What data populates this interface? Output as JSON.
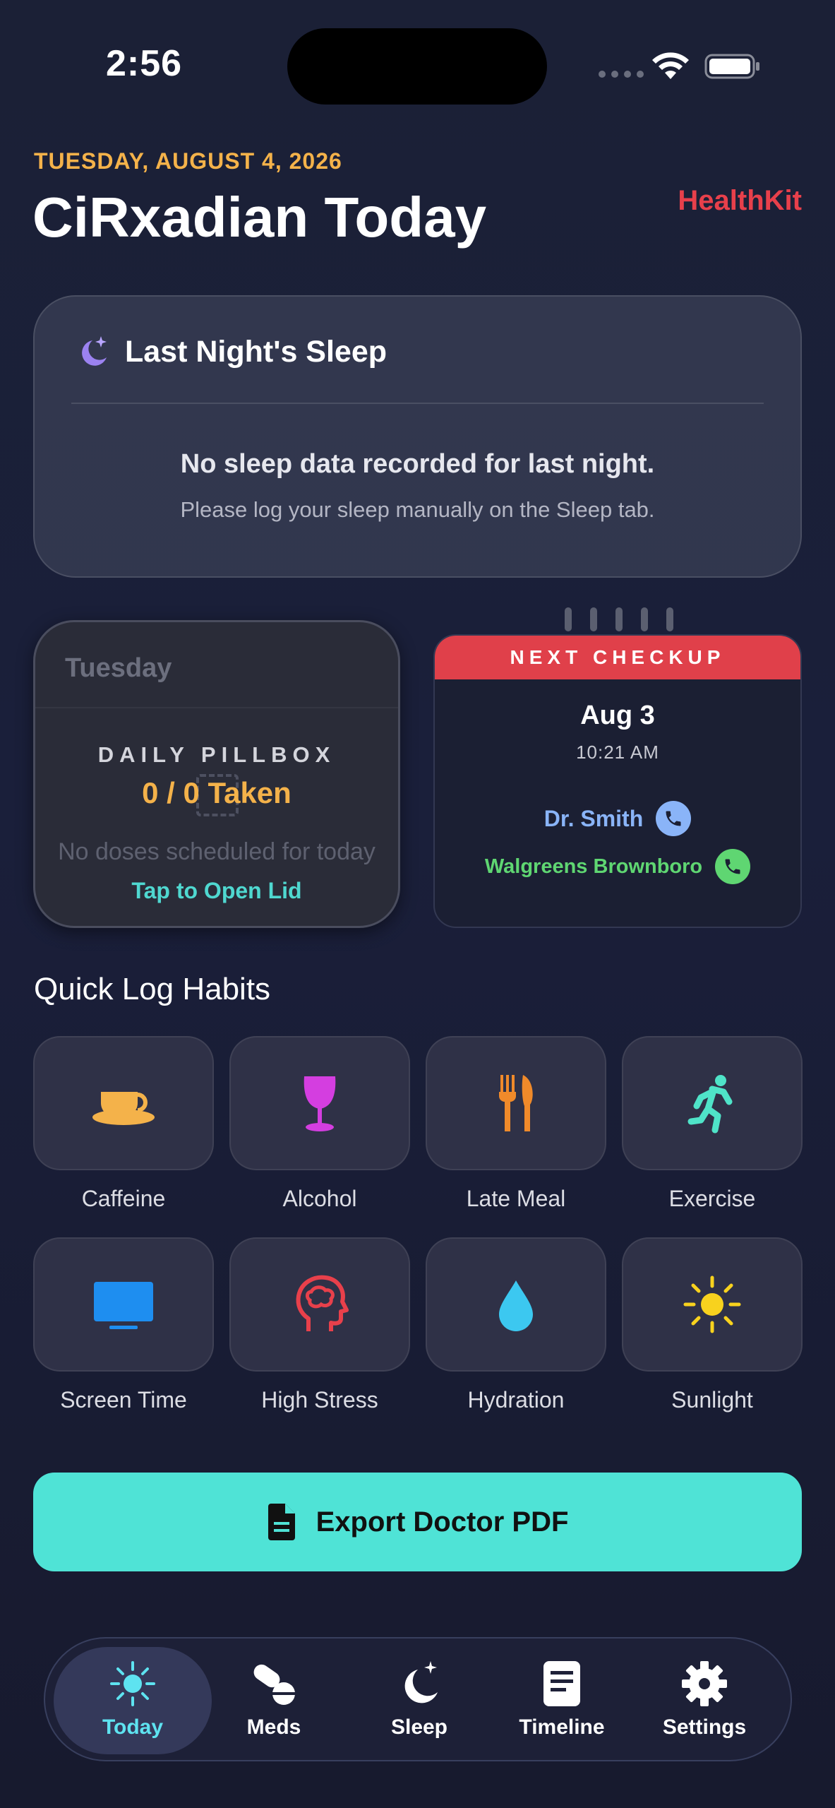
{
  "status_bar": {
    "time": "2:56"
  },
  "header": {
    "date": "TUESDAY, AUGUST 4, 2026",
    "title": "CiRxadian Today",
    "healthkit_label": "HealthKit"
  },
  "sleep_card": {
    "title": "Last Night's Sleep",
    "message": "No sleep data recorded for last night.",
    "hint": "Please log your sleep manually on the Sleep tab."
  },
  "pillbox": {
    "day": "Tuesday",
    "label": "DAILY PILLBOX",
    "count": "0 / 0 Taken",
    "empty_message": "No doses scheduled for today",
    "open_label": "Tap to Open Lid"
  },
  "checkup": {
    "banner": "NEXT CHECKUP",
    "date": "Aug 3",
    "time": "10:21 AM",
    "doctor": "Dr. Smith",
    "pharmacy": "Walgreens Brownboro"
  },
  "habits": {
    "title": "Quick Log Habits",
    "items": [
      {
        "label": "Caffeine",
        "icon": "coffee-cup-icon",
        "color": "#f4b24a"
      },
      {
        "label": "Alcohol",
        "icon": "wine-glass-icon",
        "color": "#d43ee0"
      },
      {
        "label": "Late Meal",
        "icon": "fork-knife-icon",
        "color": "#f08a2a"
      },
      {
        "label": "Exercise",
        "icon": "running-figure-icon",
        "color": "#4fe3c8"
      },
      {
        "label": "Screen Time",
        "icon": "monitor-icon",
        "color": "#1e8ef0"
      },
      {
        "label": "High Stress",
        "icon": "brain-head-icon",
        "color": "#e8404b"
      },
      {
        "label": "Hydration",
        "icon": "water-drop-icon",
        "color": "#3cc8f0"
      },
      {
        "label": "Sunlight",
        "icon": "sun-icon",
        "color": "#f8d21e"
      }
    ]
  },
  "export_button": {
    "label": "Export Doctor PDF"
  },
  "tab_bar": {
    "tabs": [
      {
        "label": "Today",
        "icon": "sun-icon",
        "active": true
      },
      {
        "label": "Meds",
        "icon": "pill-icon",
        "active": false
      },
      {
        "label": "Sleep",
        "icon": "moon-stars-icon",
        "active": false
      },
      {
        "label": "Timeline",
        "icon": "document-icon",
        "active": false
      },
      {
        "label": "Settings",
        "icon": "gear-icon",
        "active": false
      }
    ]
  },
  "colors": {
    "accent_teal": "#4fe3d6",
    "accent_orange": "#f4b24a",
    "accent_red": "#e8404b"
  }
}
